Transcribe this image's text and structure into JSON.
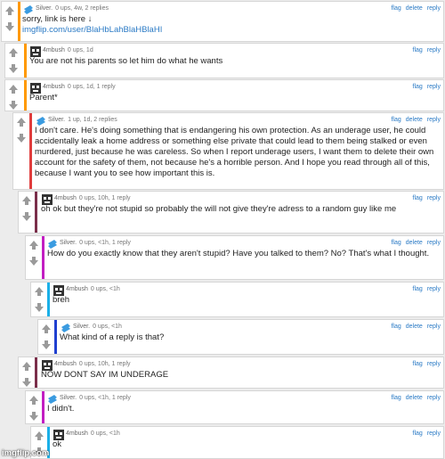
{
  "actions": {
    "flag": "flag",
    "delete": "delete",
    "reply": "reply"
  },
  "colors": {
    "silver": "#3a9be0",
    "mbush": "#333333"
  },
  "comments": [
    {
      "user": "Silver.",
      "meta": "0 ups, 4w, 2 replies",
      "text": "sorry, link is here ↓",
      "link": "imgflip.com/user/BlaHbLahBlaHBlaHI",
      "bar": "#ff9900",
      "delete": true
    },
    {
      "user": "4mbush",
      "meta": "0 ups, 1d",
      "text": "You are not his parents so let him do what he wants",
      "bar": "#ff9900",
      "delete": false
    },
    {
      "user": "4mbush",
      "meta": "0 ups, 1d, 1 reply",
      "text": "Parent*",
      "bar": "#ff9900",
      "delete": false
    },
    {
      "user": "Silver.",
      "meta": "1 up, 1d, 2 replies",
      "text": "I don't care. He's doing something that is endangering his own protection. As an underage user, he could accidentally leak a home address or something else private that could lead to them being stalked or even murdered, just because he was careless. So when I report underage users, I want them to delete their own account for the safety of them, not because he's a horrible person. And I hope you read through all of this, because I want you to see how important this is.",
      "bar": "#e03c3c",
      "delete": true
    },
    {
      "user": "4mbush",
      "meta": "0 ups, 10h, 1 reply",
      "text": "oh ok but they're not stupid so probably the will not give they're adress to a random guy like me",
      "bar": "#7a2e4a",
      "delete": false
    },
    {
      "user": "Silver.",
      "meta": "0 ups, <1h, 1 reply",
      "text": "How do you exactly know that they aren't stupid? Have you talked to them? No? That's what I thought.",
      "bar": "#c21ec2",
      "delete": true
    },
    {
      "user": "4mbush",
      "meta": "0 ups, <1h",
      "text": "breh",
      "bar": "#1ab0e8",
      "delete": false
    },
    {
      "user": "Silver.",
      "meta": "0 ups, <1h",
      "text": "What kind of a reply is that?",
      "bar": "#2040d0",
      "delete": true
    },
    {
      "user": "4mbush",
      "meta": "0 ups, 10h, 1 reply",
      "text": "NOW DONT SAY IM UNDERAGE",
      "bar": "#7a2e4a",
      "delete": false
    },
    {
      "user": "Silver.",
      "meta": "0 ups, <1h, 1 reply",
      "text": "I didn't.",
      "bar": "#c21ec2",
      "delete": true
    },
    {
      "user": "4mbush",
      "meta": "0 ups, <1h",
      "text": "ok",
      "bar": "#1ab0e8",
      "delete": false
    }
  ],
  "watermark": "imgflip.com"
}
